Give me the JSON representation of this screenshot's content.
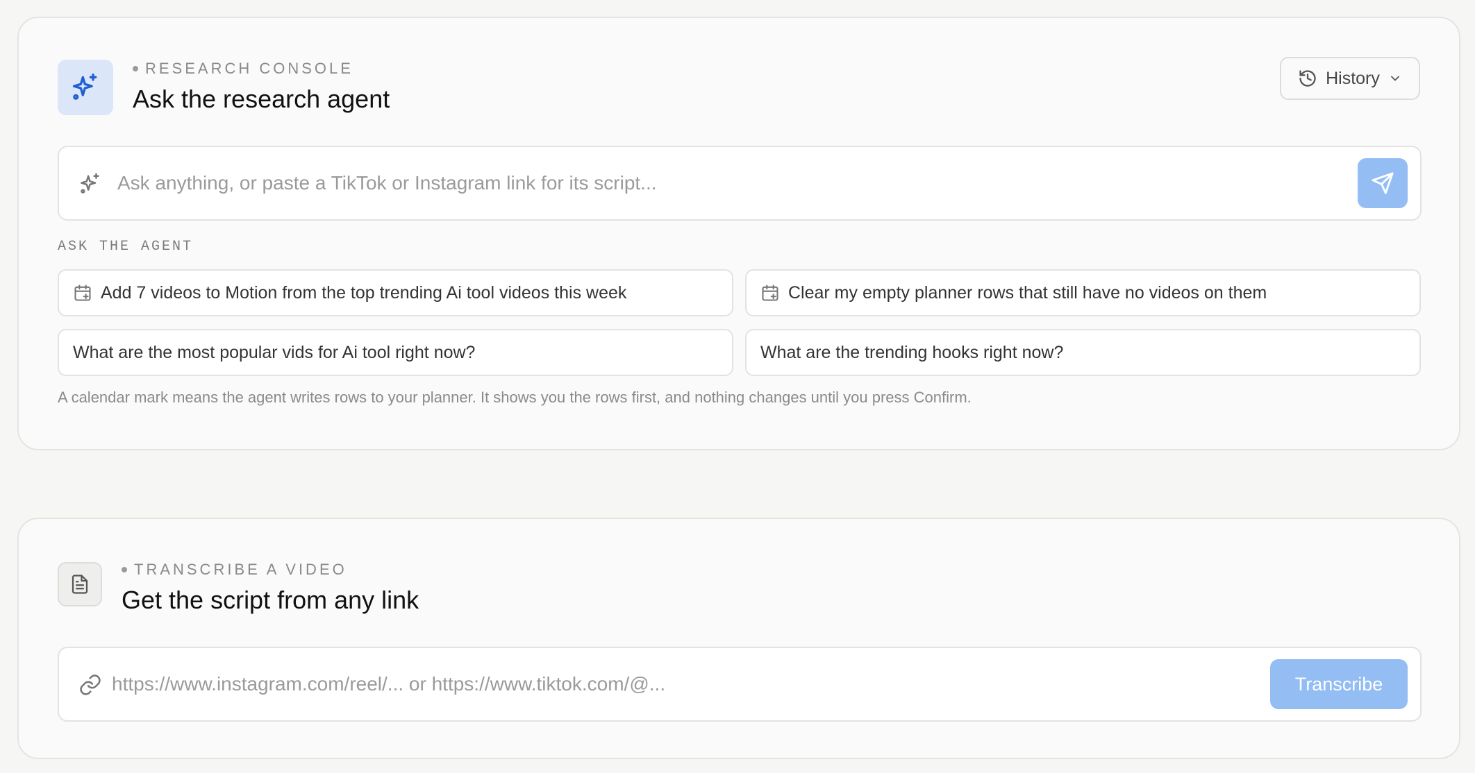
{
  "research": {
    "eyebrow": "RESEARCH CONSOLE",
    "title": "Ask the research agent",
    "history_label": "History",
    "input_placeholder": "Ask anything, or paste a TikTok or Instagram link for its script...",
    "section_label": "ASK THE AGENT",
    "suggestions": [
      {
        "label": "Add 7 videos to Motion from the top trending Ai tool videos this week",
        "icon": "calendar-plus-icon"
      },
      {
        "label": "Clear my empty planner rows that still have no videos on them",
        "icon": "calendar-plus-icon"
      },
      {
        "label": "What are the most popular vids for Ai tool right now?"
      },
      {
        "label": "What are the trending hooks right now?"
      }
    ],
    "note": "A calendar mark means the agent writes rows to your planner. It shows you the rows first, and nothing changes until you press Confirm."
  },
  "transcribe": {
    "eyebrow": "TRANSCRIBE A VIDEO",
    "title": "Get the script from any link",
    "input_placeholder": "https://www.instagram.com/reel/... or https://www.tiktok.com/@...",
    "button_label": "Transcribe"
  },
  "colors": {
    "accent": "#93bdf3",
    "accent_icon": "#1f5fd1",
    "icon_bg": "#dbe6f9"
  }
}
